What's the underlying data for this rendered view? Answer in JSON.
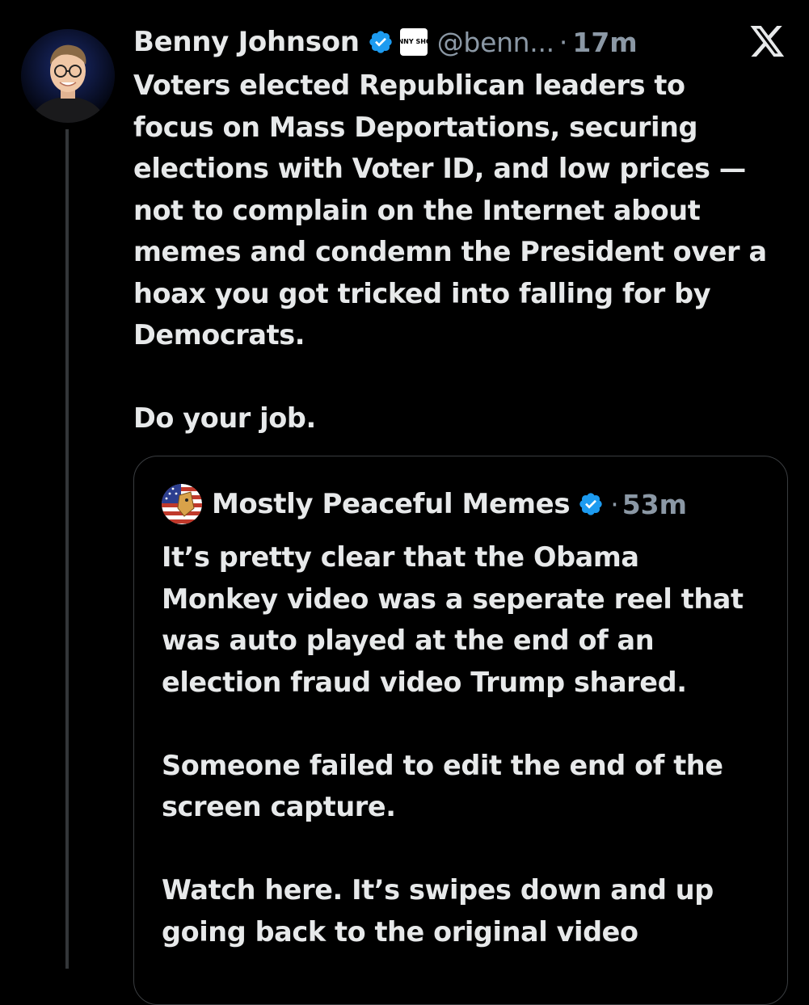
{
  "author": {
    "display_name": "Benny Johnson",
    "handle": "@benn...",
    "separator": "·",
    "time": "17m",
    "affiliate_badge": "BENNY SHOW",
    "avatar": "avatar-photo"
  },
  "tweet": {
    "text": "Voters elected Republican leaders to\nfocus on Mass Deportations, securing\nelections with Voter ID, and low prices —\nnot to complain on the Internet about\nmemes and condemn the President over a\nhoax you got tricked into falling for by\nDemocrats.\n\nDo your job."
  },
  "quoted": {
    "display_name": "Mostly Peaceful Memes",
    "separator": "·",
    "time": "53m",
    "avatar": "flag-avatar",
    "text": "It’s pretty clear that the Obama\nMonkey video was a seperate reel that\nwas auto played at the end of an\nelection fraud video Trump shared.\n\nSomeone failed to edit the end of the\nscreen capture.\n\nWatch here. It’s swipes down and up\ngoing back to the original video"
  },
  "icons": {
    "verified": "verified-badge-icon",
    "logo": "x-logo-icon"
  },
  "colors": {
    "background": "#000000",
    "text": "#e7e9ea",
    "secondary": "#8b98a5",
    "verified": "#1d9bf0",
    "border": "#3a3d40"
  }
}
